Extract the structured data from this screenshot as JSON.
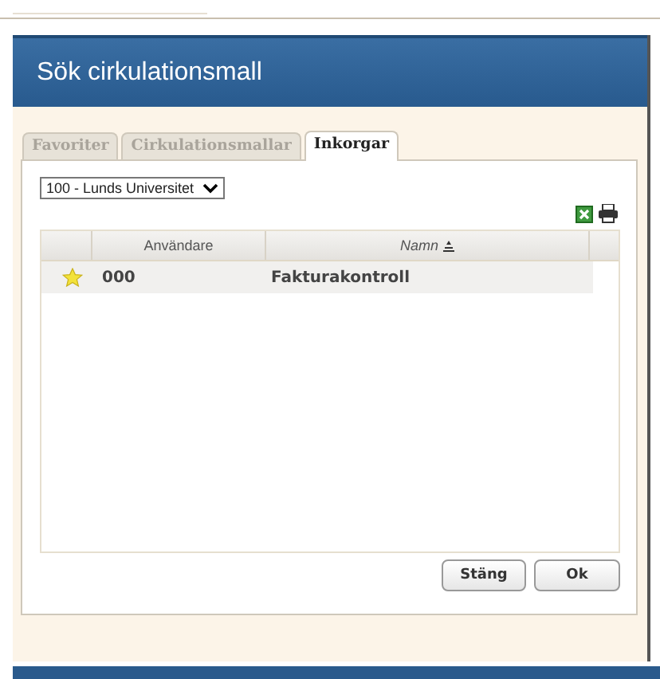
{
  "dialog": {
    "title": "Sök cirkulationsmall"
  },
  "tabs": [
    {
      "label": "Favoriter",
      "selected": false
    },
    {
      "label": "Cirkulationsmallar",
      "selected": false
    },
    {
      "label": "Inkorgar",
      "selected": true
    }
  ],
  "unit_select": {
    "value": "100 - Lunds Universitet"
  },
  "table": {
    "columns": [
      {
        "label": "Användare",
        "sorted": false
      },
      {
        "label": "Namn",
        "sorted": true
      }
    ],
    "rows": [
      {
        "favorite": true,
        "cells": [
          "000",
          "Fakturakontroll"
        ]
      }
    ]
  },
  "buttons": [
    "Stäng",
    "Ok"
  ]
}
